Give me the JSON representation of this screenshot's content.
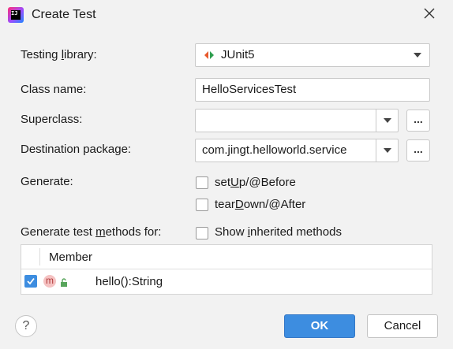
{
  "window": {
    "title": "Create Test"
  },
  "form": {
    "testing_library_label": "Testing library:",
    "testing_library_value": "JUnit5",
    "class_name_label": "Class name:",
    "class_name_value": "HelloServicesTest",
    "superclass_label": "Superclass:",
    "superclass_value": "",
    "destination_label": "Destination package:",
    "destination_value": "com.jingt.helloworld.service",
    "browse_label": "...",
    "generate_label": "Generate:",
    "setup_label": "setUp/@Before",
    "teardown_label": "tearDown/@After",
    "generate_methods_label": "Generate test methods for:",
    "show_inherited_label": "Show inherited methods"
  },
  "table": {
    "header": "Member",
    "rows": [
      {
        "checked": true,
        "badge": "m",
        "member": "hello():String"
      }
    ]
  },
  "buttons": {
    "ok": "OK",
    "cancel": "Cancel",
    "help": "?"
  },
  "colors": {
    "accent": "#3d8de0",
    "junit_green": "#2e9e4f",
    "junit_red": "#e85a2c"
  }
}
